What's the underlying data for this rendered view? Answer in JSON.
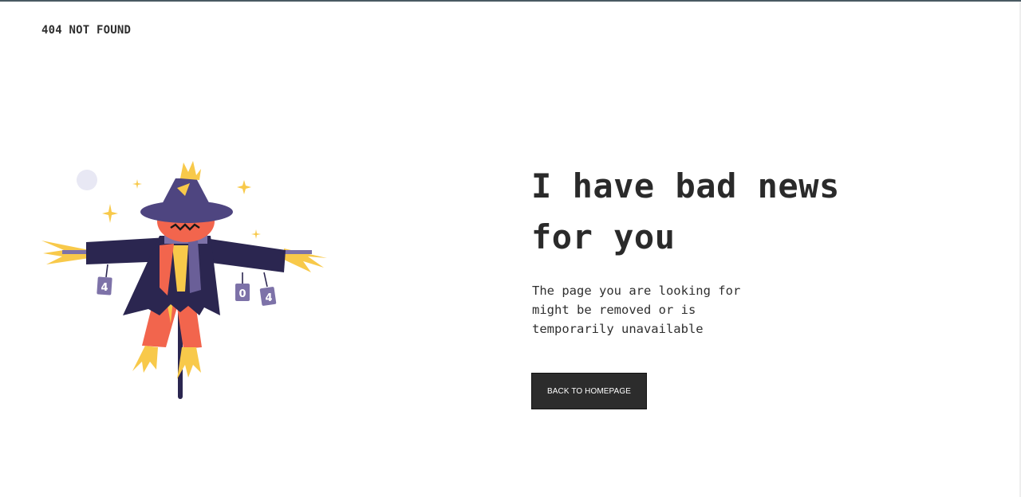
{
  "brand": {
    "label": "404 NOT FOUND"
  },
  "error": {
    "headline": "I have bad news for you",
    "message": "The page you are looking for might be removed or is temporarily unavailable"
  },
  "actions": {
    "back_home_label": "BACK TO HOMEPAGE"
  },
  "illustration": {
    "icon": "scarecrow-icon",
    "can_labels": [
      "4",
      "0",
      "4"
    ]
  },
  "colors": {
    "text": "#2c2c2c",
    "button_bg": "#2c2c2c",
    "button_text": "#ffffff",
    "scarecrow_coat": "#2b2650",
    "scarecrow_hat": "#4e4580",
    "pumpkin": "#f2654d",
    "straw": "#f8c94a",
    "can": "#7d72a8"
  }
}
